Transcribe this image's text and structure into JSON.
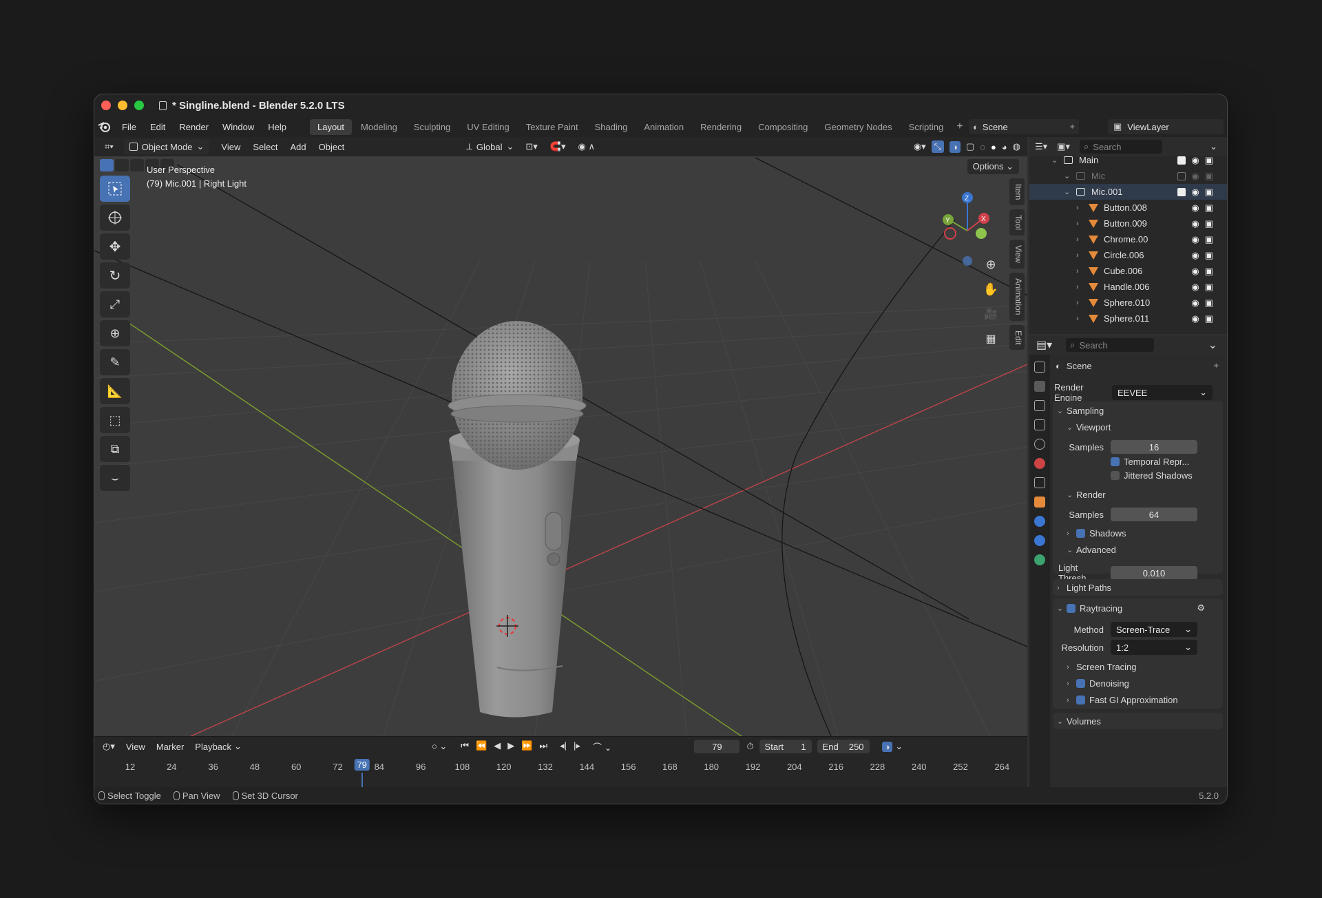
{
  "window": {
    "title": "* Singline.blend - Blender 5.2.0 LTS",
    "traffic_lights": [
      "#ff5f57",
      "#febc2e",
      "#28c840"
    ]
  },
  "menu": [
    "File",
    "Edit",
    "Render",
    "Window",
    "Help"
  ],
  "workspaces": [
    "Layout",
    "Modeling",
    "Sculpting",
    "UV Editing",
    "Texture Paint",
    "Shading",
    "Animation",
    "Rendering",
    "Compositing",
    "Geometry Nodes",
    "Scripting"
  ],
  "active_workspace": "Layout",
  "scene_name": "Scene",
  "view_layer": "ViewLayer",
  "viewport": {
    "mode": "Object Mode",
    "menus": [
      "View",
      "Select",
      "Add",
      "Object"
    ],
    "orientation": "Global",
    "options_label": "Options",
    "perspective": "User Perspective",
    "object_info": "(79) Mic.001 | Right Light",
    "side_tabs": [
      "Item",
      "Tool",
      "View",
      "Animation",
      "Edit"
    ],
    "gizmo_axes": [
      "Z",
      "Y",
      "X"
    ]
  },
  "timeline": {
    "menus": [
      "View",
      "Marker",
      "Playback"
    ],
    "current_frame": "79",
    "start_label": "Start",
    "start": "1",
    "end_label": "End",
    "end": "250",
    "ticks": [
      "12",
      "24",
      "36",
      "48",
      "60",
      "72",
      "84",
      "96",
      "108",
      "120",
      "132",
      "144",
      "156",
      "168",
      "180",
      "192",
      "204",
      "216",
      "228",
      "240",
      "252",
      "264"
    ],
    "playhead_label": "79"
  },
  "statusbar": {
    "items": [
      "Select Toggle",
      "Pan View",
      "Set 3D Cursor"
    ],
    "version": "5.2.0"
  },
  "outliner": {
    "search_placeholder": "Search",
    "rows": [
      {
        "name": "Main",
        "depth": 1,
        "type": "collection"
      },
      {
        "name": "Mic",
        "depth": 2,
        "type": "collection-off"
      },
      {
        "name": "Mic.001",
        "depth": 2,
        "type": "collection"
      },
      {
        "name": "Button.008",
        "depth": 3,
        "type": "mesh"
      },
      {
        "name": "Button.009",
        "depth": 3,
        "type": "mesh"
      },
      {
        "name": "Chrome.00",
        "depth": 3,
        "type": "mesh"
      },
      {
        "name": "Circle.006",
        "depth": 3,
        "type": "mesh"
      },
      {
        "name": "Cube.006",
        "depth": 3,
        "type": "mesh"
      },
      {
        "name": "Handle.006",
        "depth": 3,
        "type": "mesh"
      },
      {
        "name": "Sphere.010",
        "depth": 3,
        "type": "mesh"
      },
      {
        "name": "Sphere.011",
        "depth": 3,
        "type": "mesh"
      }
    ]
  },
  "properties": {
    "search_placeholder": "Search",
    "context": "Scene",
    "render_engine_label": "Render Engine",
    "render_engine": "EEVEE",
    "sampling": "Sampling",
    "viewport": "Viewport",
    "samples_label": "Samples",
    "viewport_samples": "16",
    "temporal": "Temporal Repr...",
    "jittered": "Jittered Shadows",
    "render": "Render",
    "render_samples": "64",
    "shadows": "Shadows",
    "advanced": "Advanced",
    "light_thresh_label": "Light Thresh...",
    "light_thresh": "0.010",
    "light_paths": "Light Paths",
    "raytracing": "Raytracing",
    "method_label": "Method",
    "method": "Screen-Trace",
    "resolution_label": "Resolution",
    "resolution": "1:2",
    "screen_tracing": "Screen Tracing",
    "denoising": "Denoising",
    "fast_gi": "Fast GI Approximation",
    "volumes": "Volumes"
  }
}
